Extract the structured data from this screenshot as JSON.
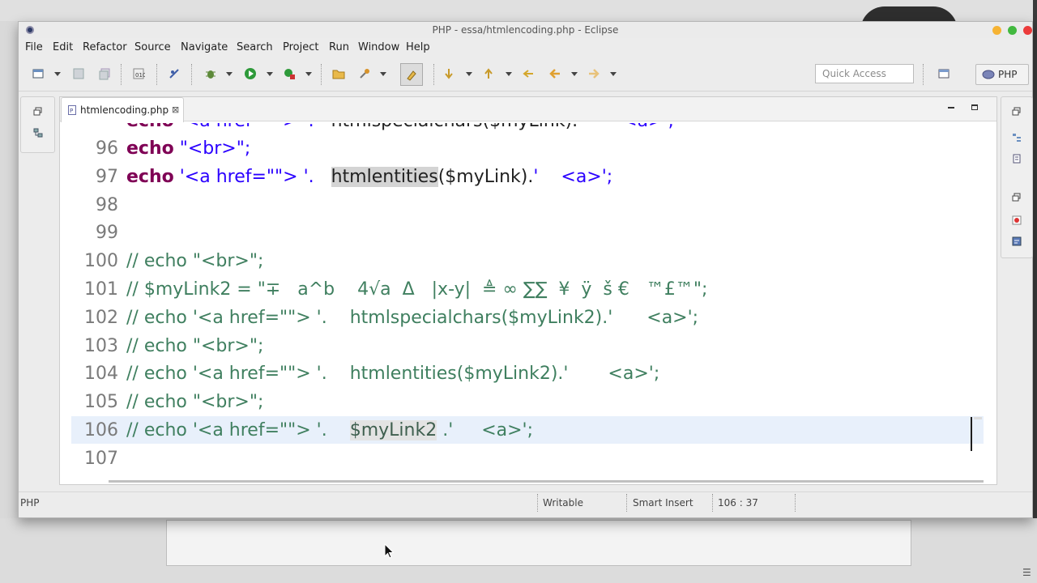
{
  "window": {
    "title": "PHP - essa/htmlencoding.php - Eclipse"
  },
  "menu": [
    "File",
    "Edit",
    "Refactor",
    "Source",
    "Navigate",
    "Search",
    "Project",
    "Run",
    "Window",
    "Help"
  ],
  "toolbar": {
    "quick_access_placeholder": "Quick Access",
    "perspective_label": "PHP"
  },
  "editor": {
    "tab_label": "htmlencoding.php",
    "tab_close": "⊠",
    "lines": [
      {
        "num": "96",
        "tokens": [
          {
            "t": "kw",
            "v": "echo"
          },
          {
            "t": "str",
            "v": " \"<br>\";"
          }
        ]
      },
      {
        "num": "97",
        "tokens": [
          {
            "t": "kw",
            "v": "echo"
          },
          {
            "t": "str",
            "v": " '<a href=\"\"> '.   "
          },
          {
            "t": "hl",
            "v": "htmlentities"
          },
          {
            "t": "fn",
            "v": "($myLink)."
          },
          {
            "t": "str",
            "v": "'    <a>';"
          }
        ]
      },
      {
        "num": "98",
        "tokens": []
      },
      {
        "num": "99",
        "tokens": []
      },
      {
        "num": "100",
        "tokens": [
          {
            "t": "cm",
            "v": "// echo \"<br>\";"
          }
        ]
      },
      {
        "num": "101",
        "tokens": [
          {
            "t": "cm",
            "v": "// $myLink2 = \"∓   a^b    4√a  Δ   |x-y|  ≜ ∞ ∑∑  ¥  ÿ  š €   ™£™\";"
          }
        ]
      },
      {
        "num": "102",
        "tokens": [
          {
            "t": "cm",
            "v": "// echo '<a href=\"\"> '.    htmlspecialchars($myLink2).'      <a>';"
          }
        ]
      },
      {
        "num": "103",
        "tokens": [
          {
            "t": "cm",
            "v": "// echo \"<br>\";"
          }
        ]
      },
      {
        "num": "104",
        "tokens": [
          {
            "t": "cm",
            "v": "// echo '<a href=\"\"> '.    htmlentities($myLink2).'       <a>';"
          }
        ]
      },
      {
        "num": "105",
        "tokens": [
          {
            "t": "cm",
            "v": "// echo \"<br>\";"
          }
        ]
      },
      {
        "num": "106",
        "current": true,
        "tokens": [
          {
            "t": "cm",
            "v": "// echo '<a href=\"\"> '.    "
          },
          {
            "t": "hl-cm",
            "v": "$myLink2"
          },
          {
            "t": "cm",
            "v": " .'     <a>';"
          }
        ]
      },
      {
        "num": "107",
        "tokens": []
      }
    ]
  },
  "status": {
    "language": "PHP",
    "mode": "Writable",
    "insert": "Smart Insert",
    "position": "106 : 37"
  },
  "colors": {
    "keyword": "#7f0055",
    "string": "#2a00ff",
    "comment": "#3f7f5f",
    "current_line": "#e8f0fb"
  }
}
